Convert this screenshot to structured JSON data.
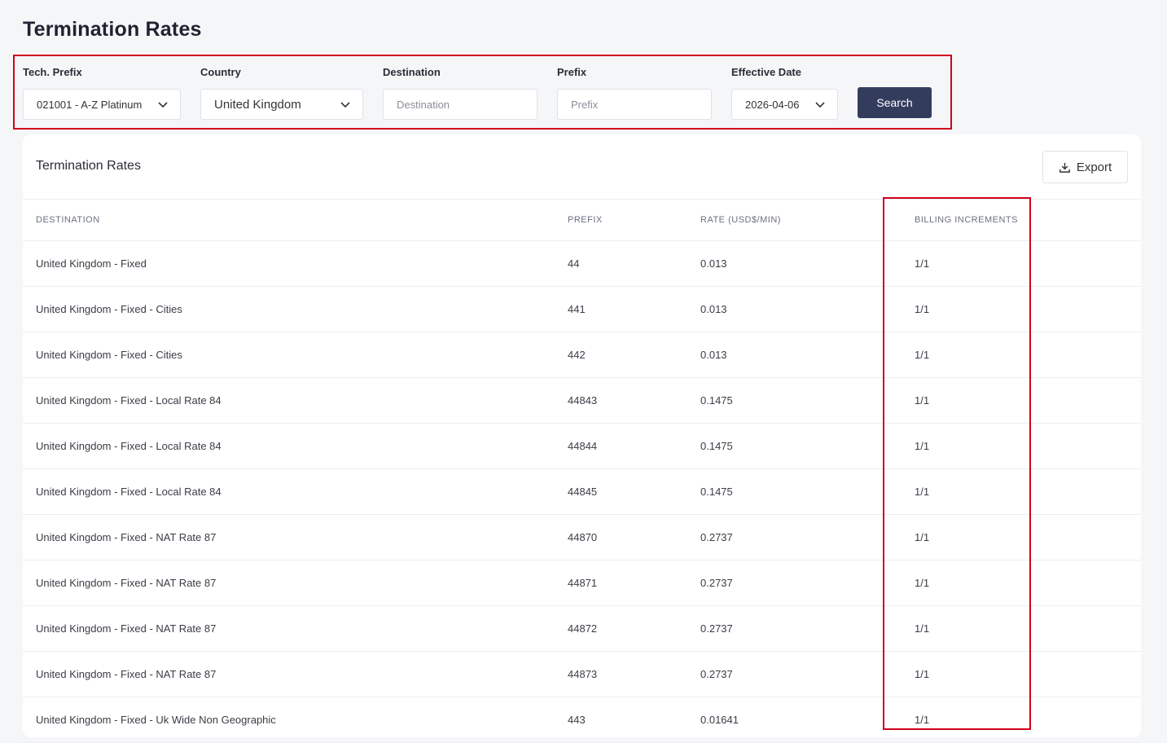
{
  "page": {
    "title": "Termination Rates"
  },
  "filters": {
    "tech_prefix": {
      "label": "Tech. Prefix",
      "value": "021001 - A-Z Platinum"
    },
    "country": {
      "label": "Country",
      "value": "United Kingdom"
    },
    "destination": {
      "label": "Destination",
      "placeholder": "Destination"
    },
    "prefix": {
      "label": "Prefix",
      "placeholder": "Prefix"
    },
    "effective_date": {
      "label": "Effective Date",
      "value": "2026-04-06"
    },
    "search_label": "Search"
  },
  "card": {
    "title": "Termination Rates",
    "export_label": "Export"
  },
  "table": {
    "headers": {
      "destination": "DESTINATION",
      "prefix": "PREFIX",
      "rate": "RATE (USD$/MIN)",
      "billing": "BILLING INCREMENTS"
    },
    "rows": [
      {
        "destination": "United Kingdom - Fixed",
        "prefix": "44",
        "rate": "0.013",
        "billing": "1/1"
      },
      {
        "destination": "United Kingdom - Fixed - Cities",
        "prefix": "441",
        "rate": "0.013",
        "billing": "1/1"
      },
      {
        "destination": "United Kingdom - Fixed - Cities",
        "prefix": "442",
        "rate": "0.013",
        "billing": "1/1"
      },
      {
        "destination": "United Kingdom - Fixed - Local Rate 84",
        "prefix": "44843",
        "rate": "0.1475",
        "billing": "1/1"
      },
      {
        "destination": "United Kingdom - Fixed - Local Rate 84",
        "prefix": "44844",
        "rate": "0.1475",
        "billing": "1/1"
      },
      {
        "destination": "United Kingdom - Fixed - Local Rate 84",
        "prefix": "44845",
        "rate": "0.1475",
        "billing": "1/1"
      },
      {
        "destination": "United Kingdom - Fixed - NAT Rate 87",
        "prefix": "44870",
        "rate": "0.2737",
        "billing": "1/1"
      },
      {
        "destination": "United Kingdom - Fixed - NAT Rate 87",
        "prefix": "44871",
        "rate": "0.2737",
        "billing": "1/1"
      },
      {
        "destination": "United Kingdom - Fixed - NAT Rate 87",
        "prefix": "44872",
        "rate": "0.2737",
        "billing": "1/1"
      },
      {
        "destination": "United Kingdom - Fixed - NAT Rate 87",
        "prefix": "44873",
        "rate": "0.2737",
        "billing": "1/1"
      },
      {
        "destination": "United Kingdom - Fixed - Uk Wide Non Geographic",
        "prefix": "443",
        "rate": "0.01641",
        "billing": "1/1"
      }
    ]
  },
  "colors": {
    "highlight": "#d0021b",
    "primary_button": "#343c5e"
  },
  "icons": {
    "dropdown": "chevron-down-icon",
    "export": "download-icon"
  }
}
